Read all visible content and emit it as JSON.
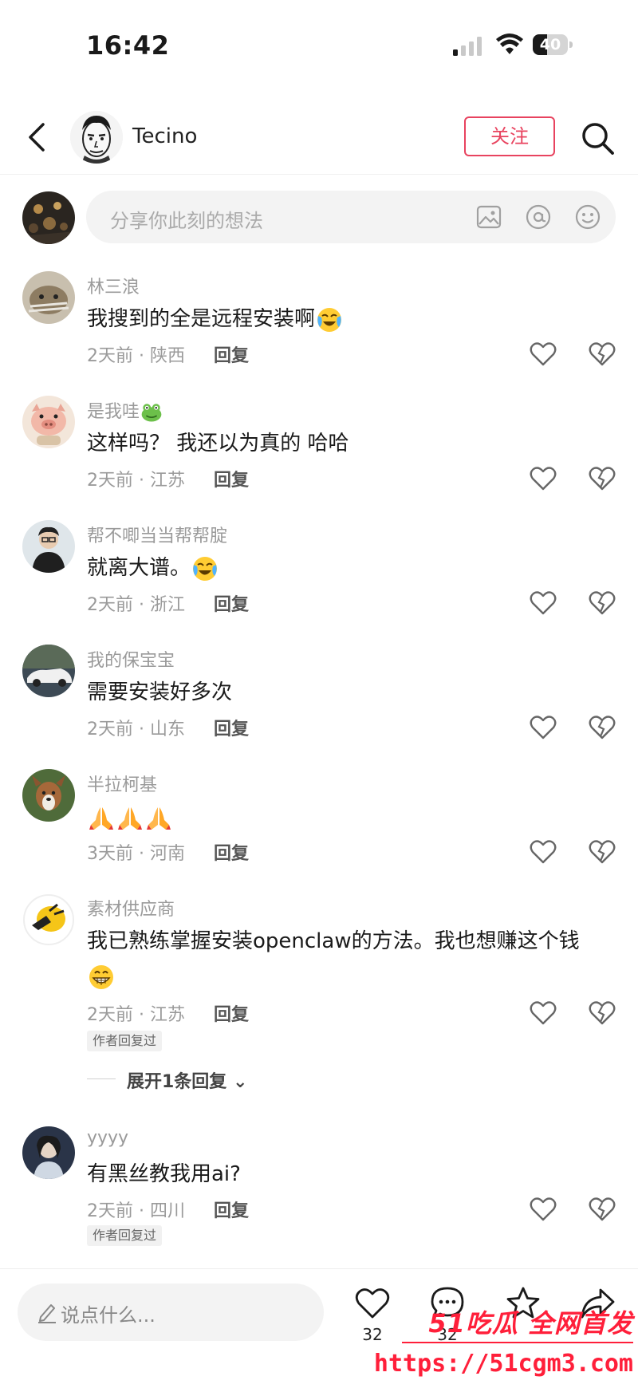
{
  "status": {
    "time": "16:42",
    "battery_text": "40",
    "battery_level": 0.4
  },
  "nav": {
    "name": "Tecino",
    "follow_label": "关注"
  },
  "composer": {
    "placeholder": "分享你此刻的想法"
  },
  "comments": [
    {
      "user": "林三浪",
      "text": "我搜到的全是远程安装啊",
      "emoji": [
        "cry-laugh"
      ],
      "meta": "2天前 · 陕西",
      "reply": "回复"
    },
    {
      "user": "是我哇",
      "user_emoji": "frog",
      "text": "这样吗？ 我还以为真的 哈哈",
      "meta": "2天前 · 江苏",
      "reply": "回复"
    },
    {
      "user": "帮不唧当当帮帮腚",
      "text": "就离大谱。",
      "emoji": [
        "cry-laugh"
      ],
      "meta": "2天前 · 浙江",
      "reply": "回复"
    },
    {
      "user": "我的保宝宝",
      "text": "需要安装好多次",
      "meta": "2天前 · 山东",
      "reply": "回复"
    },
    {
      "user": "半拉柯基",
      "text": "",
      "emoji": [
        "pray",
        "pray",
        "pray"
      ],
      "meta": "3天前 · 河南",
      "reply": "回复"
    },
    {
      "user": "素材供应商",
      "text": "我已熟练掌握安装openclaw的方法。我也想赚这个钱",
      "emoji": [
        "grin"
      ],
      "meta": "2天前 · 江苏",
      "reply": "回复",
      "author_tag": "作者回复过",
      "expand": "展开1条回复"
    },
    {
      "user": "yyyy",
      "text": "有黑丝教我用ai?",
      "meta": "2天前 · 四川",
      "reply": "回复",
      "author_tag": "作者回复过"
    }
  ],
  "bottom": {
    "input_placeholder": "说点什么...",
    "like_count": "32",
    "comment_count": "32"
  },
  "watermark": {
    "top": "51吃瓜 全网首发",
    "url": "https://51cgm3.com"
  },
  "colors": {
    "accent": "#e8435f",
    "watermark": "#ff1f3a"
  }
}
